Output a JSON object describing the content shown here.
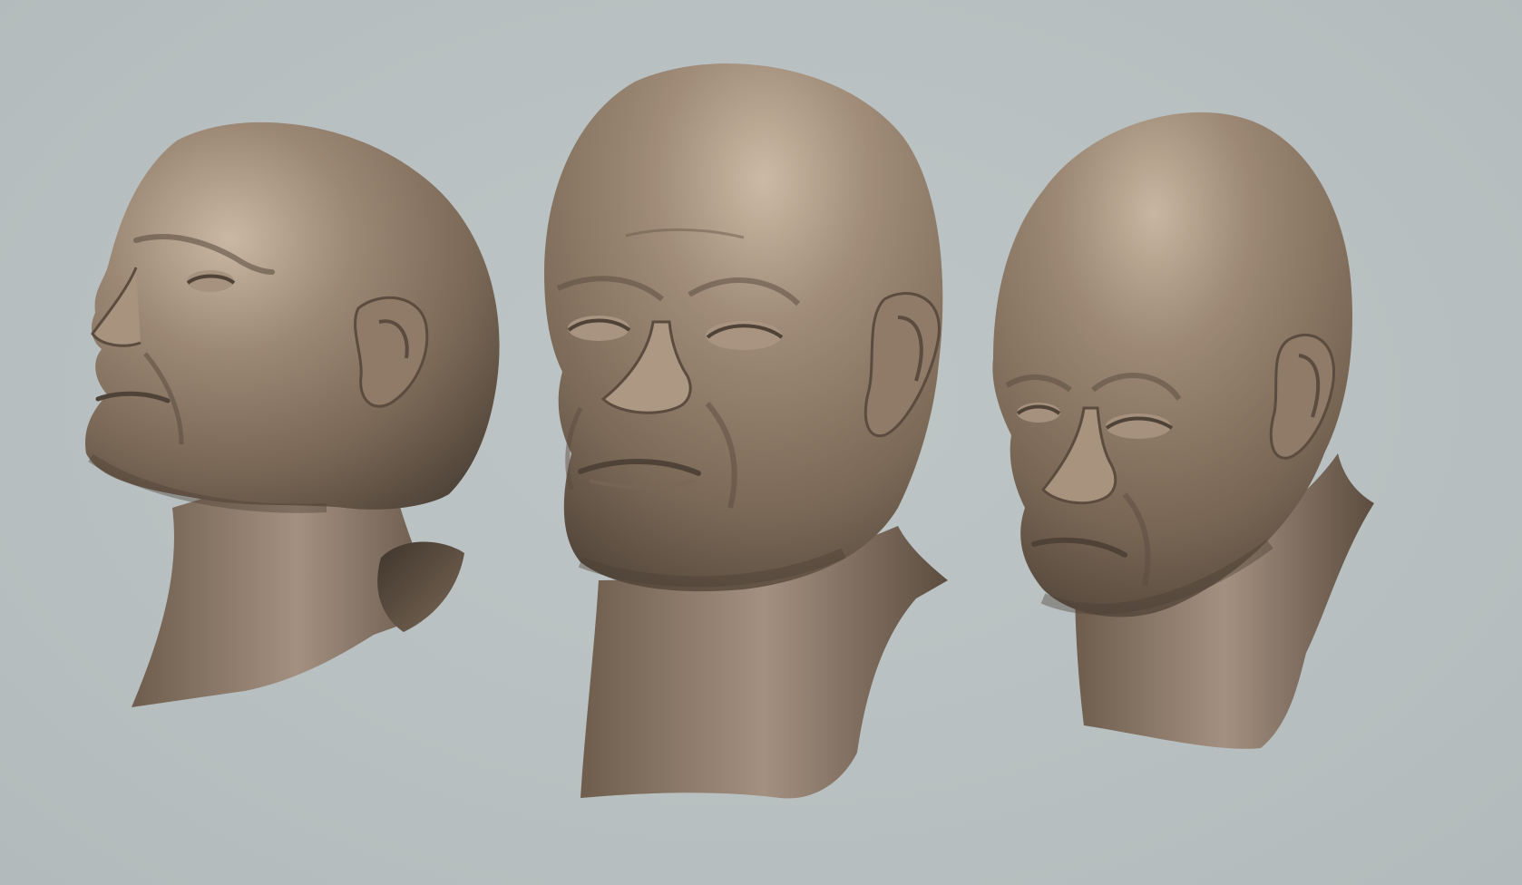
{
  "scene": {
    "background_color": "#b7bfc0",
    "clay_color": "#8a7866",
    "clay_highlight": "#cdbda9",
    "clay_shadow": "#4e4238"
  },
  "heads": [
    {
      "name": "head-three-quarter-left-upturned"
    },
    {
      "name": "head-front-three-quarter"
    },
    {
      "name": "head-three-quarter-right-downturned"
    }
  ]
}
